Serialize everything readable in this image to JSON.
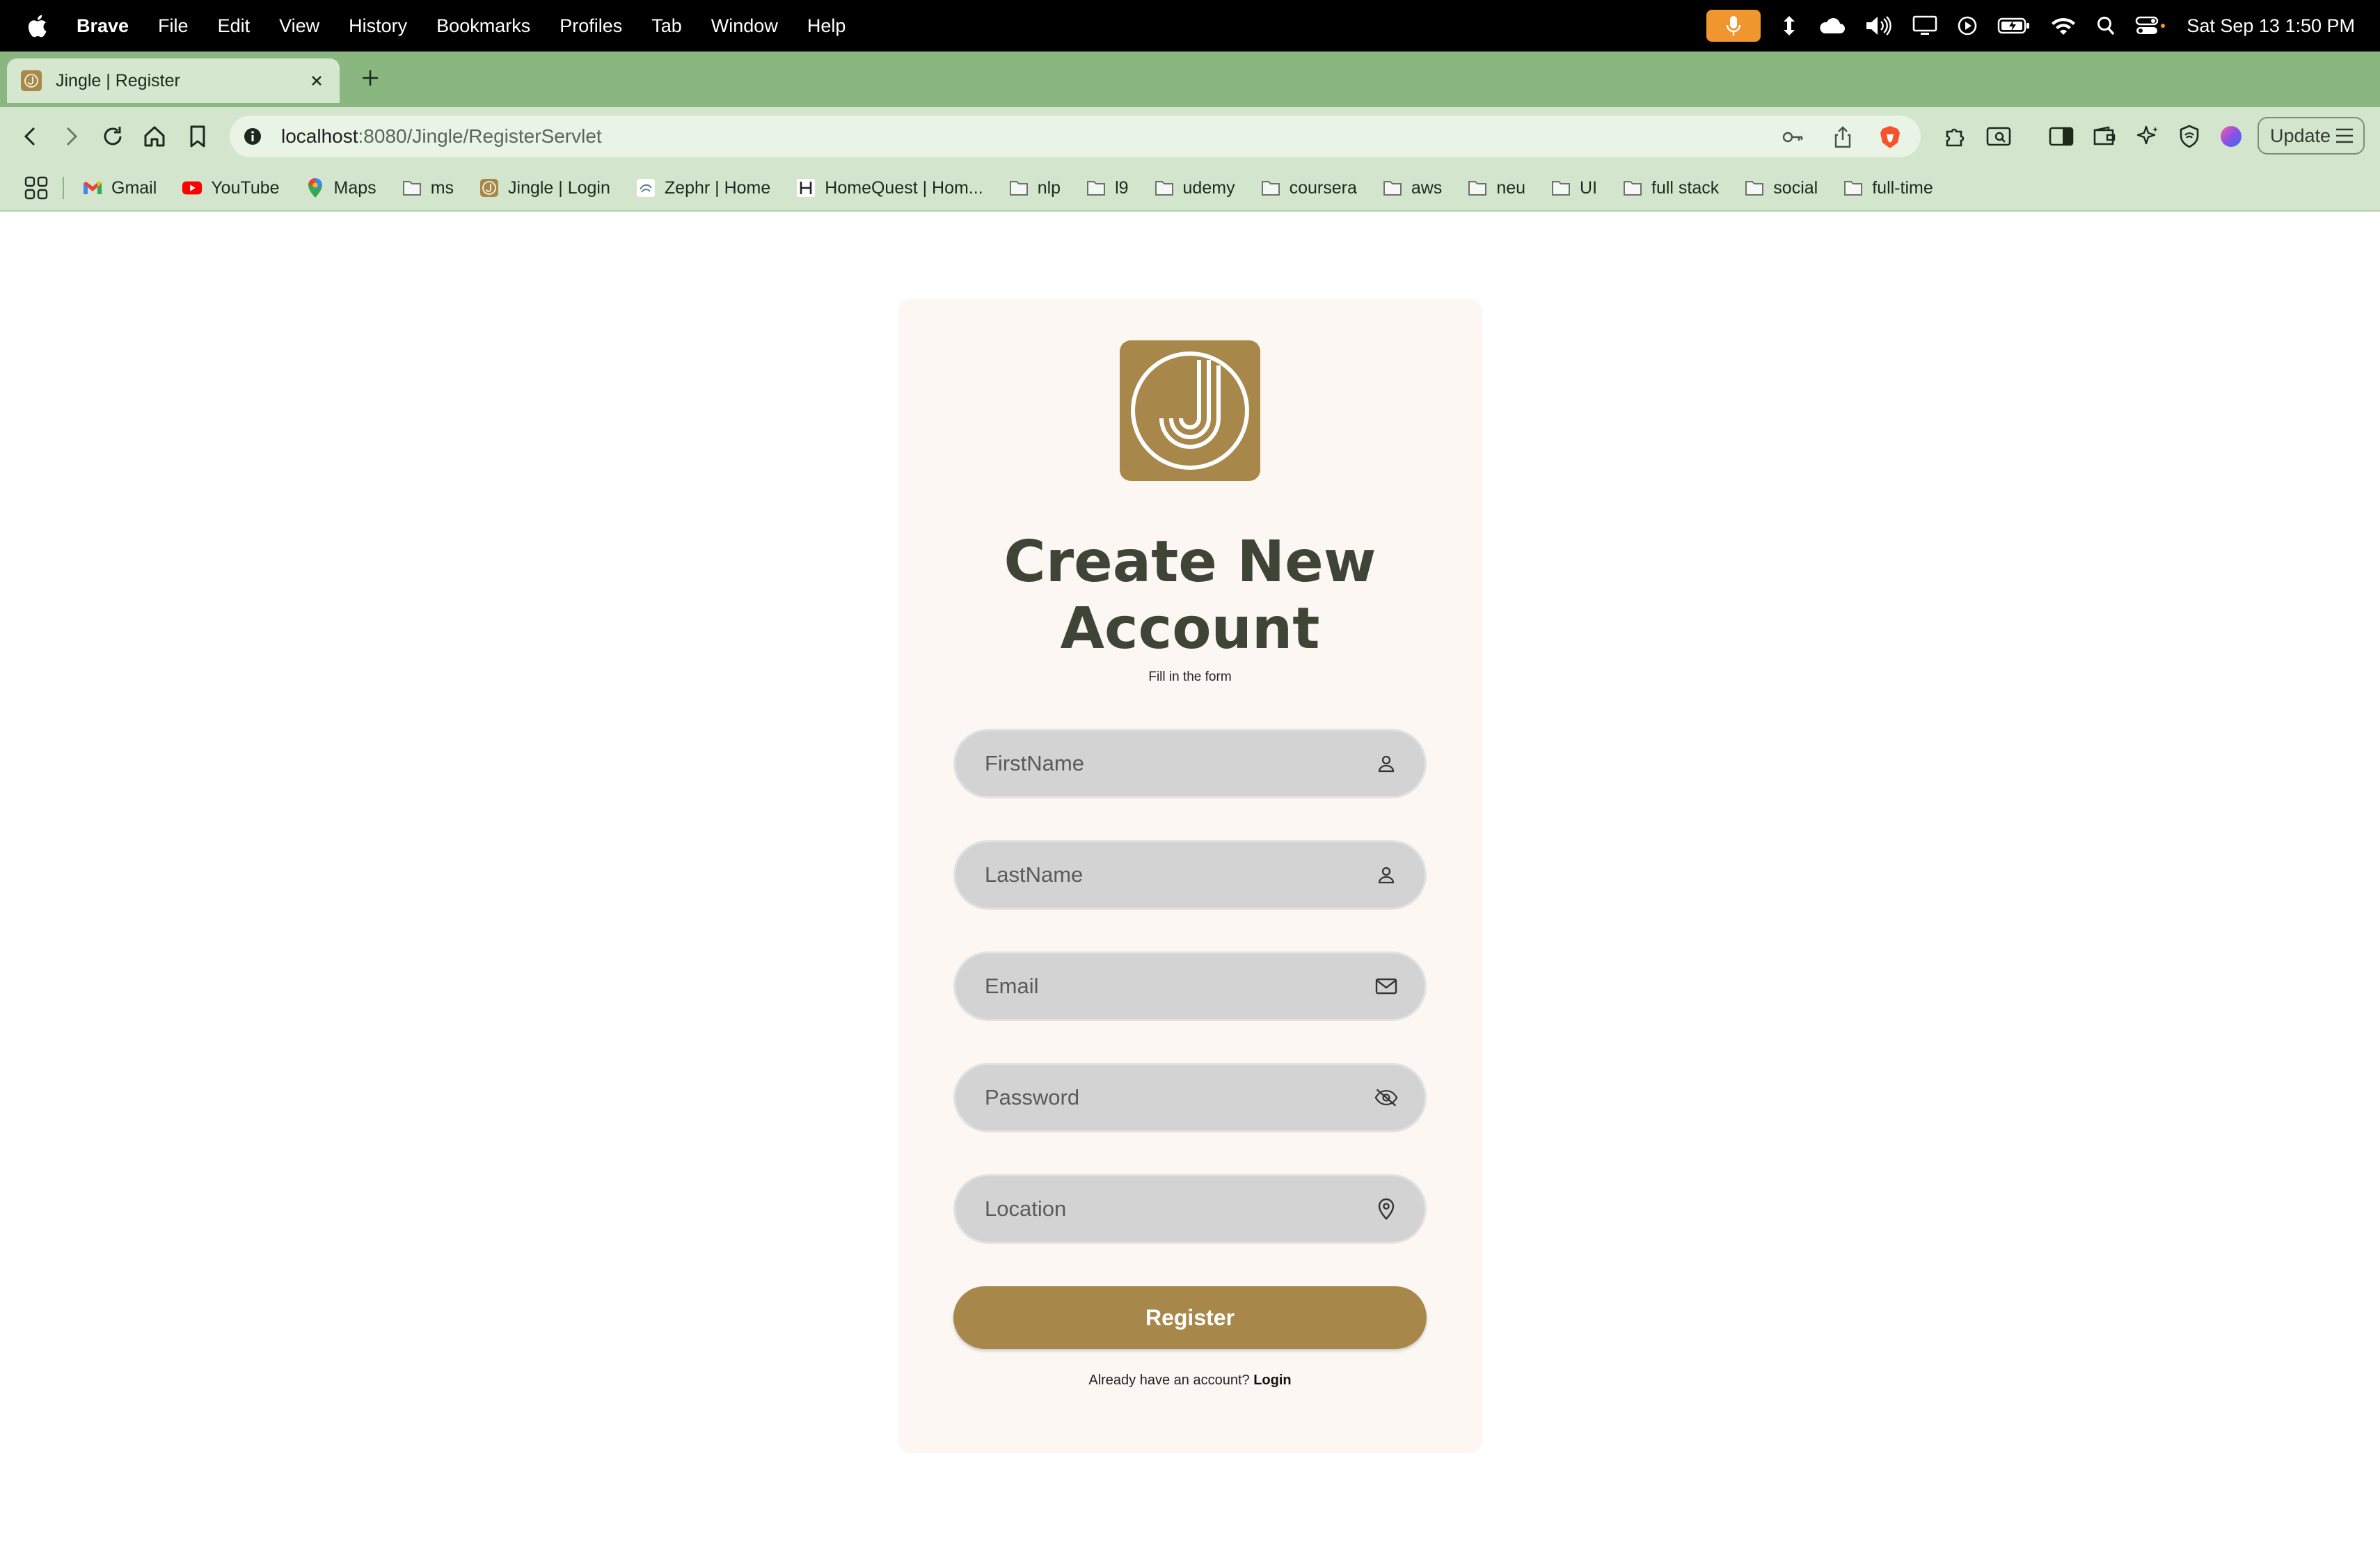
{
  "menubar": {
    "app_name": "Brave",
    "items": [
      "File",
      "Edit",
      "View",
      "History",
      "Bookmarks",
      "Profiles",
      "Tab",
      "Window",
      "Help"
    ],
    "clock": "Sat Sep 13  1:50 PM",
    "status_icons": [
      "microphone-icon",
      "sync-icon",
      "cloud-icon",
      "volume-icon",
      "display-icon",
      "play-icon",
      "battery-icon",
      "wifi-icon",
      "spotlight-icon",
      "control-center-icon"
    ]
  },
  "tab": {
    "title": "Jingle | Register"
  },
  "toolbar": {
    "url_host": "localhost",
    "url_rest": ":8080/Jingle/RegisterServlet",
    "update_label": "Update",
    "accent_color": "#f7532a"
  },
  "bookmarks": {
    "items": [
      {
        "label": "Gmail",
        "icon": "gmail-icon"
      },
      {
        "label": "YouTube",
        "icon": "youtube-icon"
      },
      {
        "label": "Maps",
        "icon": "maps-icon"
      },
      {
        "label": "ms",
        "icon": "folder-icon"
      },
      {
        "label": "Jingle | Login",
        "icon": "jingle-icon"
      },
      {
        "label": "Zephr | Home",
        "icon": "zephr-icon"
      },
      {
        "label": "HomeQuest | Hom...",
        "icon": "homequest-icon"
      },
      {
        "label": "nlp",
        "icon": "folder-icon"
      },
      {
        "label": "l9",
        "icon": "folder-icon"
      },
      {
        "label": "udemy",
        "icon": "folder-icon"
      },
      {
        "label": "coursera",
        "icon": "folder-icon"
      },
      {
        "label": "aws",
        "icon": "folder-icon"
      },
      {
        "label": "neu",
        "icon": "folder-icon"
      },
      {
        "label": "UI",
        "icon": "folder-icon"
      },
      {
        "label": "full stack",
        "icon": "folder-icon"
      },
      {
        "label": "social",
        "icon": "folder-icon"
      },
      {
        "label": "full-time",
        "icon": "folder-icon"
      }
    ]
  },
  "form": {
    "title_line1": "Create New",
    "title_line2": "Account",
    "subtitle": "Fill in the form",
    "fields": [
      {
        "placeholder": "FirstName",
        "icon": "user-icon"
      },
      {
        "placeholder": "LastName",
        "icon": "user-icon"
      },
      {
        "placeholder": "Email",
        "icon": "mail-icon"
      },
      {
        "placeholder": "Password",
        "icon": "eye-slash-icon"
      },
      {
        "placeholder": "Location",
        "icon": "location-pin-icon"
      }
    ],
    "register_label": "Register",
    "login_prompt": "Already have an account?",
    "login_link": "Login"
  },
  "colors": {
    "brand": "#a8884a",
    "tab_strip": "#8ab780",
    "toolbar": "#d3e6cd",
    "card": "#fdf7f3",
    "title": "#3e4436",
    "field": "#d3d3d3"
  }
}
